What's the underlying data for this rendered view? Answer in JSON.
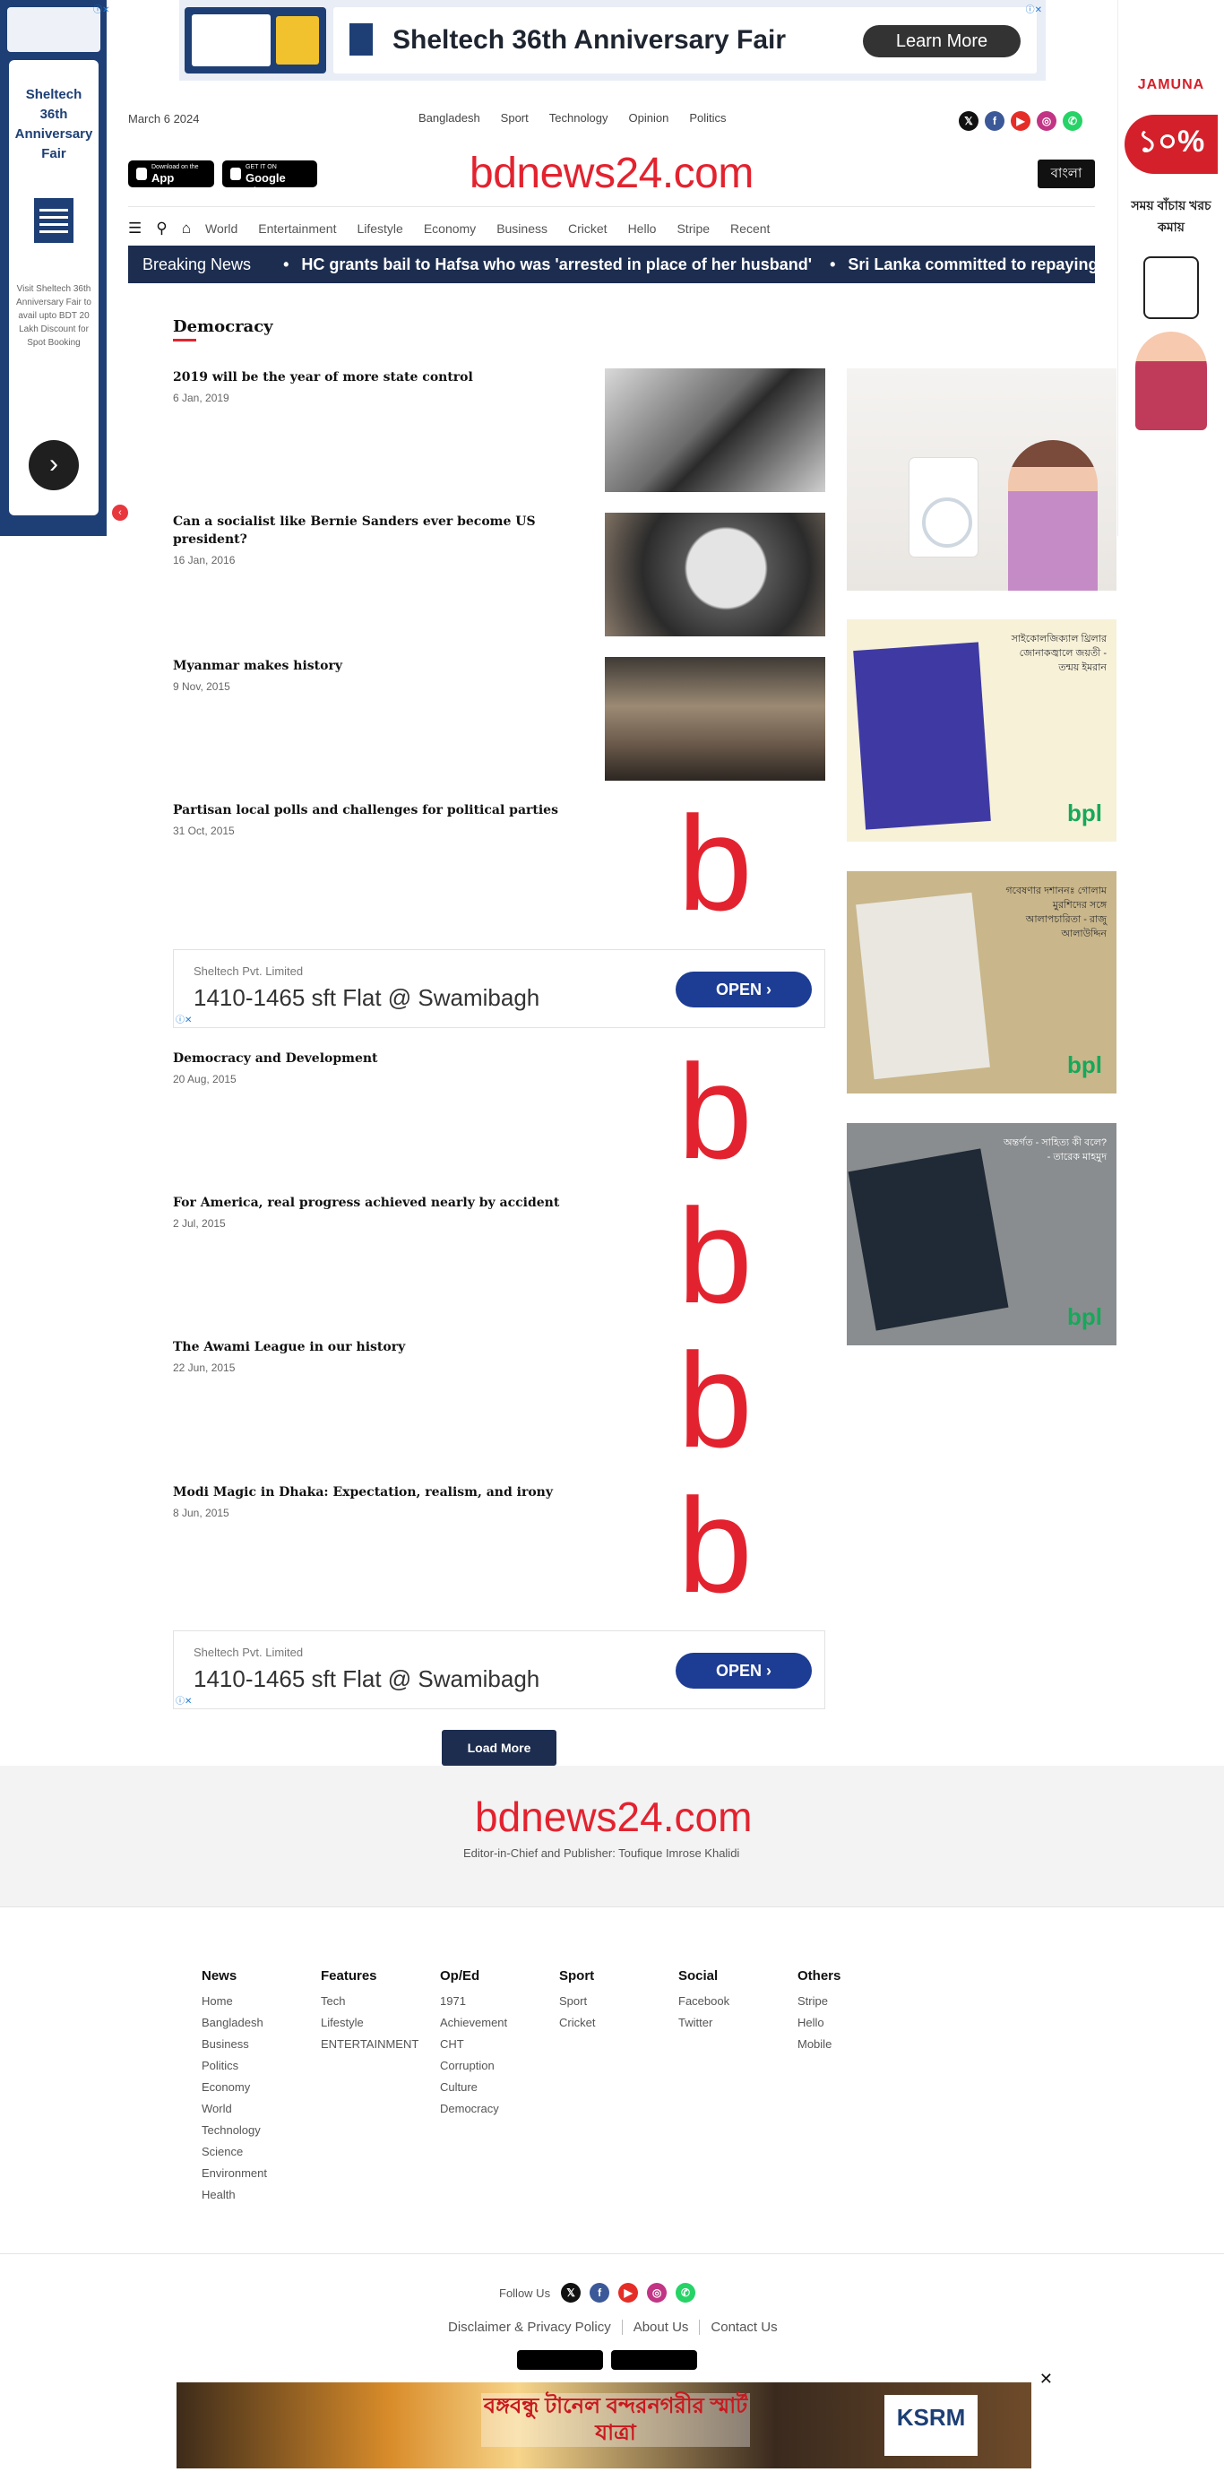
{
  "top_banner": {
    "headline": "Sheltech 36th Anniversary Fair",
    "cta": "Learn More"
  },
  "left_ad": {
    "title": "Sheltech 36th Anniversary Fair",
    "description": "Visit Sheltech 36th Anniversary Fair to avail upto BDT 20 Lakh Discount for Spot Booking",
    "arrow": "›"
  },
  "right_ad": {
    "brand": "JAMUNA",
    "percent": "১০%",
    "tagline": "সময় বাঁচায় খরচ কমায়"
  },
  "header": {
    "date": "March 6 2024",
    "top_nav": [
      "Bangladesh",
      "Sport",
      "Technology",
      "Opinion",
      "Politics"
    ],
    "logo": "bdnews24.com",
    "language_button": "বাংলা",
    "app_store": {
      "small": "Download on the",
      "big": "App Store"
    },
    "google_play": {
      "small": "GET IT ON",
      "big": "Google Play"
    }
  },
  "main_nav": [
    "World",
    "Entertainment",
    "Lifestyle",
    "Economy",
    "Business",
    "Cricket",
    "Hello",
    "Stripe",
    "Recent"
  ],
  "breaking": {
    "label": "Breaking News",
    "items": [
      "HC grants bail to Hafsa who was 'arrested in place of her husband'",
      "Sri Lanka committed to repaying"
    ]
  },
  "section": {
    "title": "Democracy",
    "articles": [
      {
        "title": "2019 will be the year of more state control",
        "date": "6 Jan, 2019"
      },
      {
        "title": "Can a socialist like Bernie Sanders ever become US president?",
        "date": "16 Jan, 2016"
      },
      {
        "title": "Myanmar makes history",
        "date": "9 Nov, 2015"
      },
      {
        "title": "Partisan local polls and challenges for political parties",
        "date": "31 Oct, 2015"
      },
      {
        "title": "Democracy and Development",
        "date": "20 Aug, 2015"
      },
      {
        "title": "For America, real progress achieved nearly by accident",
        "date": "2 Jul, 2015"
      },
      {
        "title": "The Awami League in our history",
        "date": "22 Jun, 2015"
      },
      {
        "title": "Modi Magic in Dhaka: Expectation, realism, and irony",
        "date": "8 Jun, 2015"
      }
    ],
    "placeholder_logo": "b",
    "load_more": "Load More"
  },
  "inline_ad": {
    "company": "Sheltech Pvt. Limited",
    "headline": "1410-1465 sft Flat @ Swamibagh",
    "cta": "OPEN ›"
  },
  "sidebar_ads": [
    {
      "text": ""
    },
    {
      "text": "সাইকোলজিক্যাল থ্রিলার জোনাকজ্বালে জয়তী - তন্ময় ইমরান",
      "brand": "bpl"
    },
    {
      "text": "গবেষণার দশাননঃ গোলাম মুরশিদের সঙ্গে আলাপচারিতা - রাজু আলাউদ্দিন",
      "brand": "bpl"
    },
    {
      "text": "অন্তর্গত - সাহিত্য কী বলে? - তারেক মাহমুদ",
      "brand": "bpl"
    }
  ],
  "footer": {
    "logo": "bdnews24.com",
    "editor": "Editor-in-Chief and Publisher: Toufique Imrose Khalidi",
    "columns": [
      {
        "heading": "News",
        "links": [
          "Home",
          "Bangladesh",
          "Business",
          "Politics",
          "Economy",
          "World",
          "Technology",
          "Science",
          "Environment",
          "Health"
        ]
      },
      {
        "heading": "Features",
        "links": [
          "Tech",
          "Lifestyle",
          "ENTERTAINMENT"
        ]
      },
      {
        "heading": "Op/Ed",
        "links": [
          "1971",
          "Achievement",
          "CHT",
          "Corruption",
          "Culture",
          "Democracy"
        ]
      },
      {
        "heading": "Sport",
        "links": [
          "Sport",
          "Cricket"
        ]
      },
      {
        "heading": "Social",
        "links": [
          "Facebook",
          "Twitter"
        ]
      },
      {
        "heading": "Others",
        "links": [
          "Stripe",
          "Hello",
          "Mobile"
        ]
      }
    ],
    "follow_label": "Follow Us",
    "bottom_links": [
      "Disclaimer & Privacy Policy",
      "About Us",
      "Contact Us"
    ]
  },
  "sticky_ad": {
    "title": "বঙ্গবন্ধু টানেল বন্দরনগরীর স্মার্ট যাত্রা",
    "brand": "KSRM",
    "close": "✕"
  }
}
